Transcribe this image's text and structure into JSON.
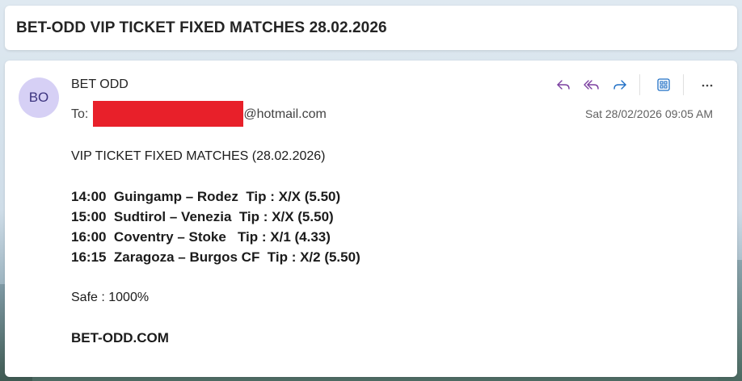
{
  "subject": "BET-ODD VIP TICKET FIXED MATCHES 28.02.2026",
  "sender": {
    "initials": "BO",
    "name": "BET ODD",
    "avatar_color": "#d6d0f5"
  },
  "recipient": {
    "label": "To:",
    "email_suffix": "@hotmail.com",
    "redaction_color": "#e8202a"
  },
  "date": "Sat 28/02/2026 09:05 AM",
  "toolbar": {
    "reply_icon": "reply-icon",
    "reply_all_icon": "reply-all-icon",
    "forward_icon": "forward-icon",
    "apps_icon": "apps-icon",
    "more_icon": "more-icon"
  },
  "body": {
    "heading": "VIP TICKET FIXED MATCHES (28.02.2026)",
    "matches": [
      "14:00  Guingamp – Rodez  Tip : X/X (5.50)",
      "15:00  Sudtirol – Venezia  Tip : X/X (5.50)",
      "16:00  Coventry – Stoke   Tip : X/1 (4.33)",
      "16:15  Zaragoza – Burgos CF  Tip : X/2 (5.50)"
    ],
    "safe": "Safe : 1000%",
    "website": "BET-ODD.COM"
  }
}
